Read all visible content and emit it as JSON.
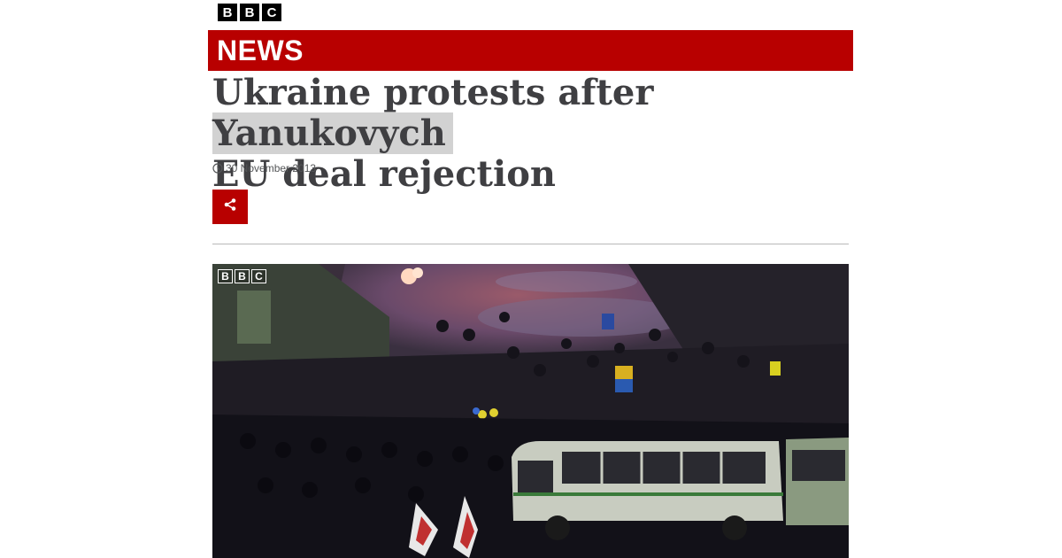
{
  "brand": {
    "logo_letters": [
      "B",
      "B",
      "C"
    ],
    "section": "NEWS",
    "accent_color": "#b80000"
  },
  "article": {
    "headline_part1": "Ukraine protests after ",
    "headline_highlight": "Yanukovych",
    "headline_part2": "EU deal rejection",
    "date": "30 November 2013"
  },
  "icons": {
    "clock": "clock-icon",
    "share": "share-icon"
  },
  "media": {
    "watermark_letters": [
      "B",
      "B",
      "C"
    ]
  }
}
